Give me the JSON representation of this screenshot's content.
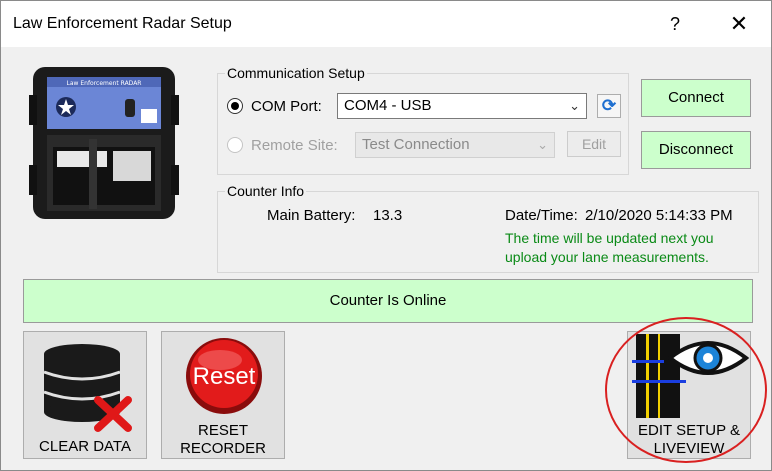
{
  "window": {
    "title": "Law Enforcement Radar Setup",
    "help_label": "?",
    "close_label": "✕"
  },
  "device": {
    "label": "Law Enforcement RADAR"
  },
  "communication": {
    "group_label": "Communication Setup",
    "com_port_label": "COM Port:",
    "com_port_value": "COM4 - USB",
    "remote_site_label": "Remote Site:",
    "remote_site_value": "Test Connection",
    "edit_label": "Edit",
    "refresh_icon": "⟳"
  },
  "actions": {
    "connect_label": "Connect",
    "disconnect_label": "Disconnect"
  },
  "counter_info": {
    "group_label": "Counter Info",
    "battery_label": "Main Battery:",
    "battery_value": "13.3",
    "datetime_label": "Date/Time:",
    "datetime_value": "2/10/2020 5:14:33 PM",
    "note_line1": "The time will be updated next you",
    "note_line2": "upload your lane measurements."
  },
  "status": {
    "text": "Counter Is Online"
  },
  "buttons": {
    "clear_label": "CLEAR DATA",
    "reset_icon_text": "Reset",
    "reset_line1": "RESET",
    "reset_line2": "RECORDER",
    "edit_line1": "EDIT SETUP &",
    "edit_line2": "LIVEVIEW"
  },
  "colors": {
    "green_button": "#ccffcc",
    "note_text": "#0a8a16",
    "highlight_ring": "#d92020",
    "refresh_icon": "#1e6fd0"
  }
}
